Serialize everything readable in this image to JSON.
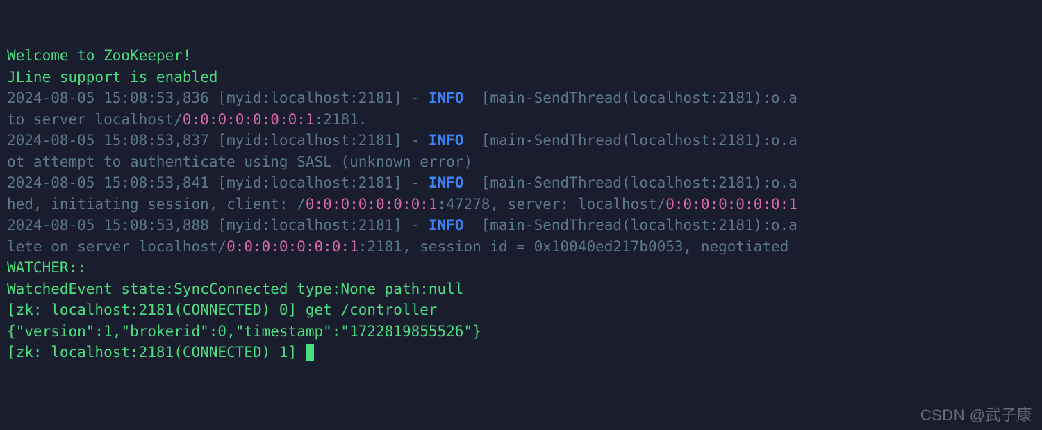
{
  "lines": [
    [
      {
        "cls": "g",
        "t": "Welcome to ZooKeeper!"
      }
    ],
    [
      {
        "cls": "g",
        "t": "JLine support is enabled"
      }
    ],
    [
      {
        "cls": "dim",
        "t": "2024-08-05 15:08:53,836 [myid:localhost:2181] - "
      },
      {
        "cls": "bl",
        "t": "INFO"
      },
      {
        "cls": "dim",
        "t": "  [main-SendThread(localhost:2181):o.a"
      }
    ],
    [
      {
        "cls": "dim",
        "t": "to server localhost/"
      },
      {
        "cls": "pk",
        "t": "0:0:0:0:0:0:0:1"
      },
      {
        "cls": "dim",
        "t": ":2181."
      }
    ],
    [
      {
        "cls": "dim",
        "t": "2024-08-05 15:08:53,837 [myid:localhost:2181] - "
      },
      {
        "cls": "bl",
        "t": "INFO"
      },
      {
        "cls": "dim",
        "t": "  [main-SendThread(localhost:2181):o.a"
      }
    ],
    [
      {
        "cls": "dim",
        "t": "ot attempt to authenticate using SASL (unknown error)"
      }
    ],
    [
      {
        "cls": "dim",
        "t": "2024-08-05 15:08:53,841 [myid:localhost:2181] - "
      },
      {
        "cls": "bl",
        "t": "INFO"
      },
      {
        "cls": "dim",
        "t": "  [main-SendThread(localhost:2181):o.a"
      }
    ],
    [
      {
        "cls": "dim",
        "t": "hed, initiating session, client: /"
      },
      {
        "cls": "pk",
        "t": "0:0:0:0:0:0:0:1"
      },
      {
        "cls": "dim",
        "t": ":47278, server: localhost/"
      },
      {
        "cls": "pk",
        "t": "0:0:0:0:0:0:0:1"
      }
    ],
    [
      {
        "cls": "dim",
        "t": "2024-08-05 15:08:53,888 [myid:localhost:2181] - "
      },
      {
        "cls": "bl",
        "t": "INFO"
      },
      {
        "cls": "dim",
        "t": "  [main-SendThread(localhost:2181):o.a"
      }
    ],
    [
      {
        "cls": "dim",
        "t": "lete on server localhost/"
      },
      {
        "cls": "pk",
        "t": "0:0:0:0:0:0:0:1"
      },
      {
        "cls": "dim",
        "t": ":2181, session id = 0x10040ed217b0053, negotiated "
      }
    ],
    [
      {
        "cls": "g",
        "t": ""
      }
    ],
    [
      {
        "cls": "g",
        "t": "WATCHER::"
      }
    ],
    [
      {
        "cls": "g",
        "t": ""
      }
    ],
    [
      {
        "cls": "g",
        "t": "WatchedEvent state:SyncConnected type:None path:null"
      }
    ],
    [
      {
        "cls": "g",
        "t": "[zk: localhost:2181(CONNECTED) 0] get /controller"
      }
    ],
    [
      {
        "cls": "g",
        "t": "{\"version\":1,\"brokerid\":0,\"timestamp\":\"1722819855526\"}"
      }
    ],
    [
      {
        "cls": "g",
        "t": "[zk: localhost:2181(CONNECTED) 1] "
      },
      {
        "cls": "cursor",
        "t": ""
      }
    ]
  ],
  "watermark": "CSDN @武子康"
}
